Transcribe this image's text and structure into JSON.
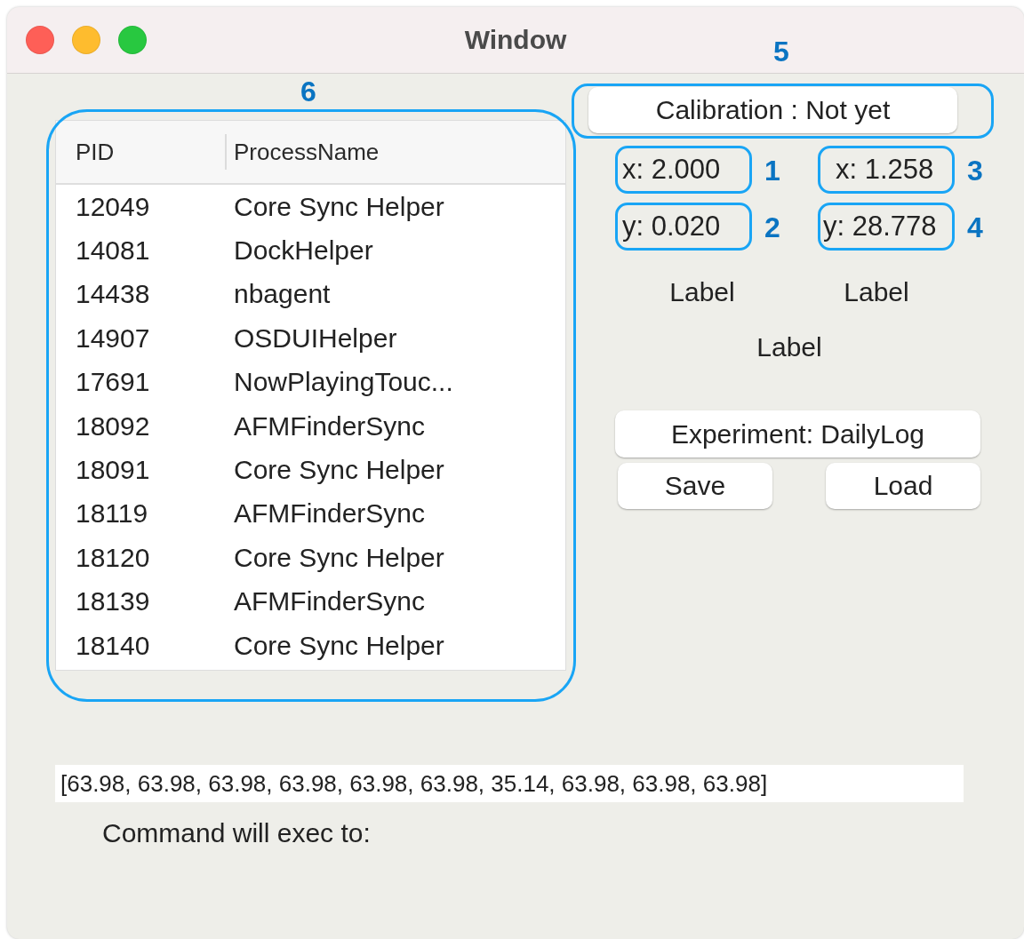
{
  "window": {
    "title": "Window"
  },
  "process_table": {
    "marker": "6",
    "columns": [
      "PID",
      "ProcessName"
    ],
    "rows": [
      [
        "12049",
        "Core Sync Helper"
      ],
      [
        "14081",
        "DockHelper"
      ],
      [
        "14438",
        "nbagent"
      ],
      [
        "14907",
        "OSDUIHelper"
      ],
      [
        "17691",
        "NowPlayingTouc..."
      ],
      [
        "18092",
        "AFMFinderSync"
      ],
      [
        "18091",
        "Core Sync Helper"
      ],
      [
        "18119",
        "AFMFinderSync"
      ],
      [
        "18120",
        "Core Sync Helper"
      ],
      [
        "18139",
        "AFMFinderSync"
      ],
      [
        "18140",
        "Core Sync Helper"
      ]
    ]
  },
  "calibration": {
    "label": "Calibration : Not yet",
    "marker": "5"
  },
  "coordinates": [
    {
      "text": "x: 2.000",
      "marker": "1"
    },
    {
      "text": "x: 1.258",
      "marker": "3"
    },
    {
      "text": "y: 0.020",
      "marker": "2"
    },
    {
      "text": "y: 28.778",
      "marker": "4"
    }
  ],
  "labels": [
    "Label",
    "Label",
    "Label"
  ],
  "experiment_button": "Experiment: DailyLog",
  "buttons": [
    "Save",
    "Load"
  ],
  "values_field": {
    "value": "[63.98, 63.98, 63.98, 63.98, 63.98, 63.98, 35.14, 63.98, 63.98, 63.98]"
  },
  "command_label": "Command will exec to:"
}
